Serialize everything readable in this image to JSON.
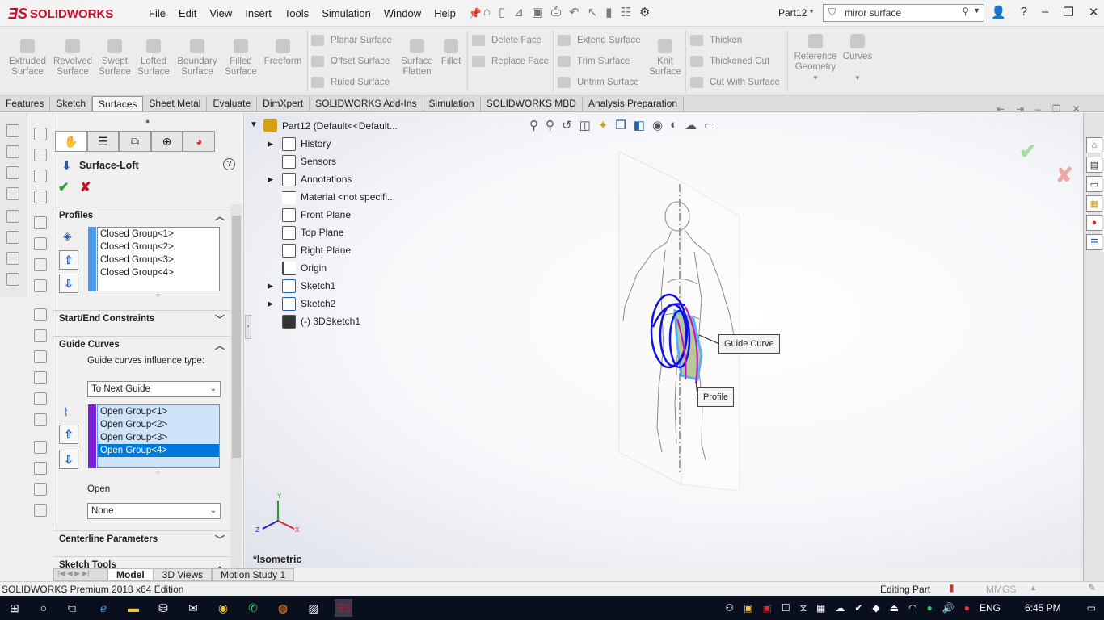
{
  "app": {
    "title": "Part12 *",
    "search_value": "miror surface"
  },
  "menu": [
    "File",
    "Edit",
    "View",
    "Insert",
    "Tools",
    "Simulation",
    "Window",
    "Help"
  ],
  "ribbon": {
    "big": [
      "Extruded\nSurface",
      "Revolved\nSurface",
      "Swept\nSurface",
      "Lofted\nSurface",
      "Boundary\nSurface",
      "Filled\nSurface",
      "Freeform"
    ],
    "col1": [
      "Planar Surface",
      "Offset Surface",
      "Ruled Surface"
    ],
    "col2": [
      "Surface\nFlatten",
      "Fillet"
    ],
    "col3": [
      "Delete Face",
      "Replace Face"
    ],
    "col4": [
      "Extend Surface",
      "Trim Surface",
      "Untrim Surface"
    ],
    "knit": "Knit\nSurface",
    "col5": [
      "Thicken",
      "Thickened Cut",
      "Cut With Surface"
    ],
    "refgeom": "Reference\nGeometry",
    "curves": "Curves"
  },
  "tabs": [
    "Features",
    "Sketch",
    "Surfaces",
    "Sheet Metal",
    "Evaluate",
    "DimXpert",
    "SOLIDWORKS Add-Ins",
    "Simulation",
    "SOLIDWORKS MBD",
    "Analysis Preparation"
  ],
  "active_tab": "Surfaces",
  "property_manager": {
    "title": "Surface-Loft",
    "profiles": {
      "header": "Profiles",
      "items": [
        "Closed Group<1>",
        "Closed Group<2>",
        "Closed Group<3>",
        "Closed Group<4>"
      ]
    },
    "start_end": {
      "header": "Start/End Constraints"
    },
    "guide_curves": {
      "header": "Guide Curves",
      "influence_label": "Guide curves influence type:",
      "influence_value": "To Next Guide",
      "items": [
        "Open Group<1>",
        "Open Group<2>",
        "Open Group<3>",
        "Open Group<4>"
      ],
      "selected_index": 3
    },
    "open_label": "Open",
    "open_value": "None",
    "centerline": {
      "header": "Centerline Parameters"
    },
    "sketch_tools": {
      "header": "Sketch Tools"
    }
  },
  "tree": {
    "root": "Part12  (Default<<Default...",
    "items": [
      "History",
      "Sensors",
      "Annotations",
      "Material <not specifi...",
      "Front Plane",
      "Top Plane",
      "Right Plane",
      "Origin",
      "Sketch1",
      "Sketch2",
      "(-) 3DSketch1"
    ]
  },
  "callouts": {
    "guide": "Guide Curve",
    "profile": "Profile"
  },
  "view": {
    "label": "*Isometric",
    "axes": [
      "Y",
      "Z",
      "X"
    ]
  },
  "bottom_tabs": [
    "Model",
    "3D Views",
    "Motion Study 1"
  ],
  "status": {
    "left": "SOLIDWORKS Premium 2018 x64 Edition",
    "mode": "Editing Part",
    "units": "MMGS"
  },
  "taskbar": {
    "lang": "ENG",
    "time": "6:45 PM"
  },
  "colors": {
    "accent": "#0078d7",
    "profile_bar": "#4d9be6",
    "guide_bar": "#7a1fd4",
    "sketch_blue": "#1010e0",
    "brand": "#c8102e"
  }
}
